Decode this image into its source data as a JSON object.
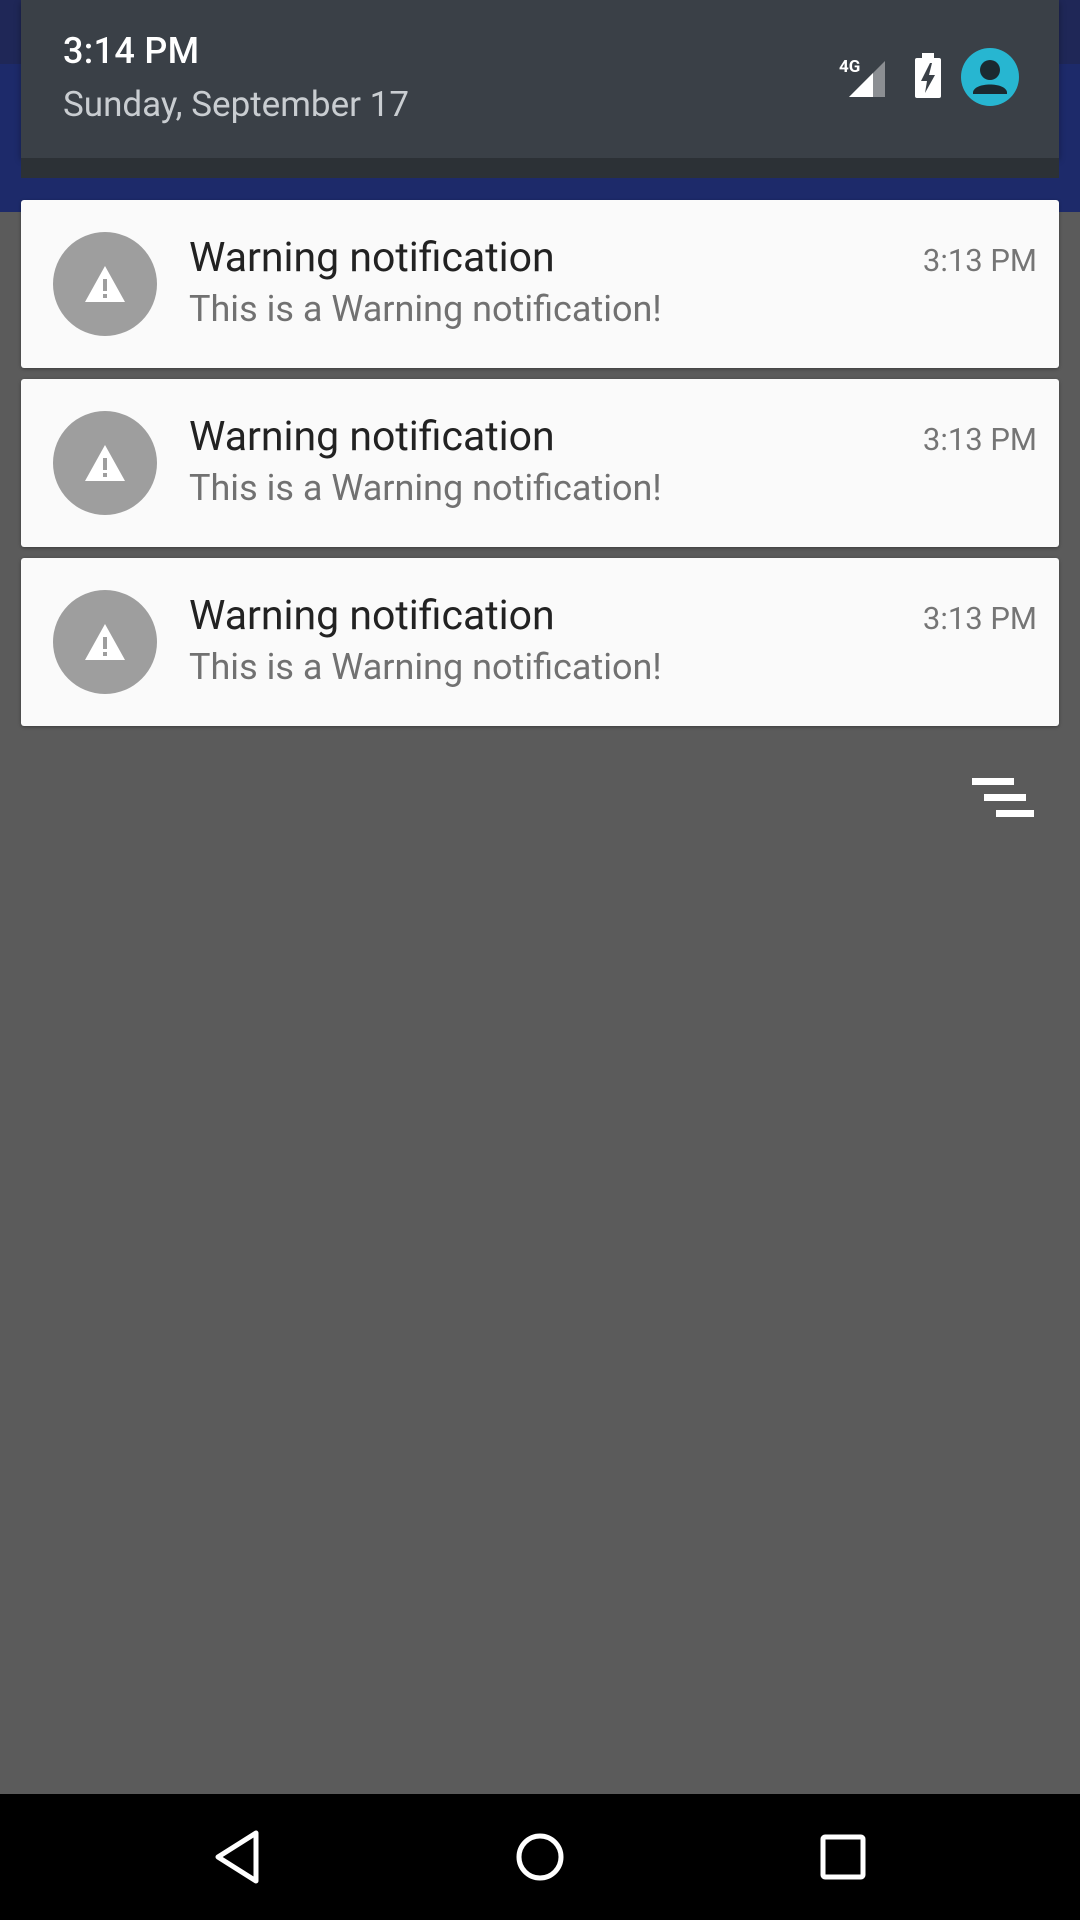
{
  "status_header": {
    "time": "3:14 PM",
    "date": "Sunday, September 17",
    "network_label": "4G",
    "icons": [
      "signal-4g-icon",
      "battery-charging-icon",
      "user-avatar-icon"
    ],
    "avatar_color": "#27b6d1"
  },
  "notifications": [
    {
      "title": "Warning notification",
      "text": "This is a Warning notification!",
      "time": "3:13 PM",
      "icon": "warning-icon"
    },
    {
      "title": "Warning notification",
      "text": "This is a Warning notification!",
      "time": "3:13 PM",
      "icon": "warning-icon"
    },
    {
      "title": "Warning notification",
      "text": "This is a Warning notification!",
      "time": "3:13 PM",
      "icon": "warning-icon"
    }
  ],
  "clear_all": {
    "icon": "clear-all-icon"
  },
  "nav_bar": {
    "buttons": [
      "back-icon",
      "home-icon",
      "recents-icon"
    ]
  },
  "colors": {
    "shade_background": "#5b5b5b",
    "header_background": "#3a4047",
    "card_background": "#fafafa",
    "icon_circle": "#9e9e9e"
  }
}
